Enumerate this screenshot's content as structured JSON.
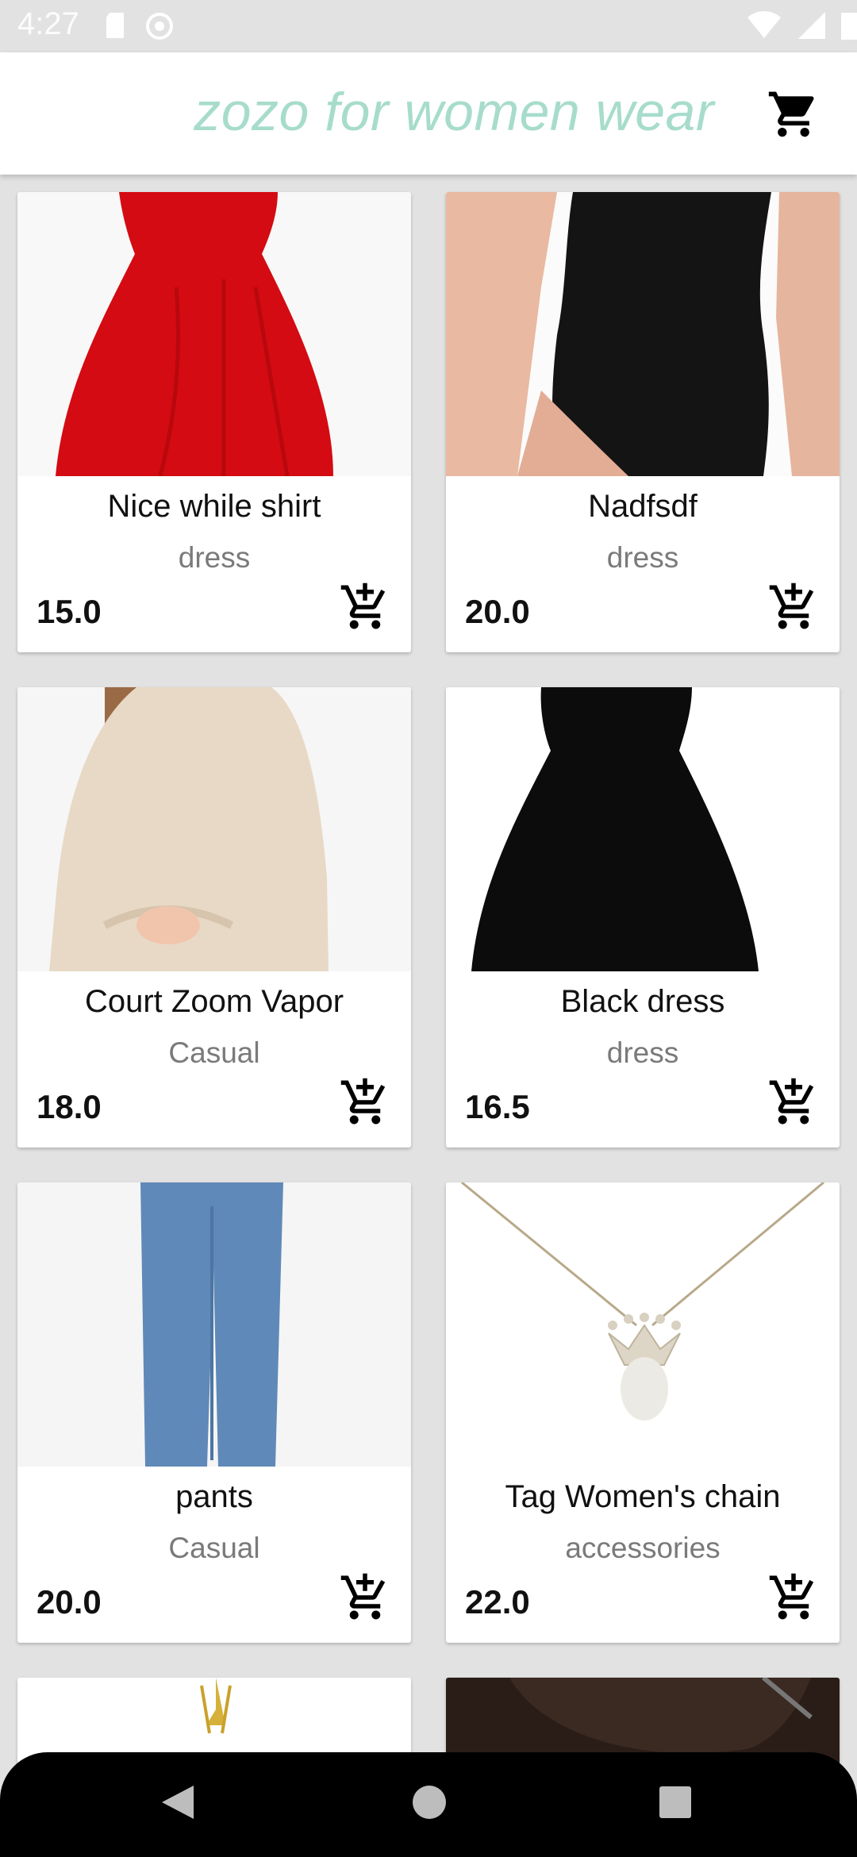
{
  "status_bar": {
    "time": "4:27"
  },
  "app_bar": {
    "title": "zozo for women wear"
  },
  "products": [
    {
      "name": "Nice while shirt",
      "category": "dress",
      "price": "15.0"
    },
    {
      "name": "Nadfsdf",
      "category": "dress",
      "price": "20.0"
    },
    {
      "name": "Court Zoom Vapor",
      "category": "Casual",
      "price": "18.0"
    },
    {
      "name": "Black dress",
      "category": "dress",
      "price": "16.5"
    },
    {
      "name": "pants",
      "category": "Casual",
      "price": "20.0"
    },
    {
      "name": "Tag Women's chain",
      "category": "accessories",
      "price": "22.0"
    }
  ],
  "colors": {
    "title": "#a7dccc",
    "background": "#e2e2e2",
    "nav": "#000000"
  }
}
